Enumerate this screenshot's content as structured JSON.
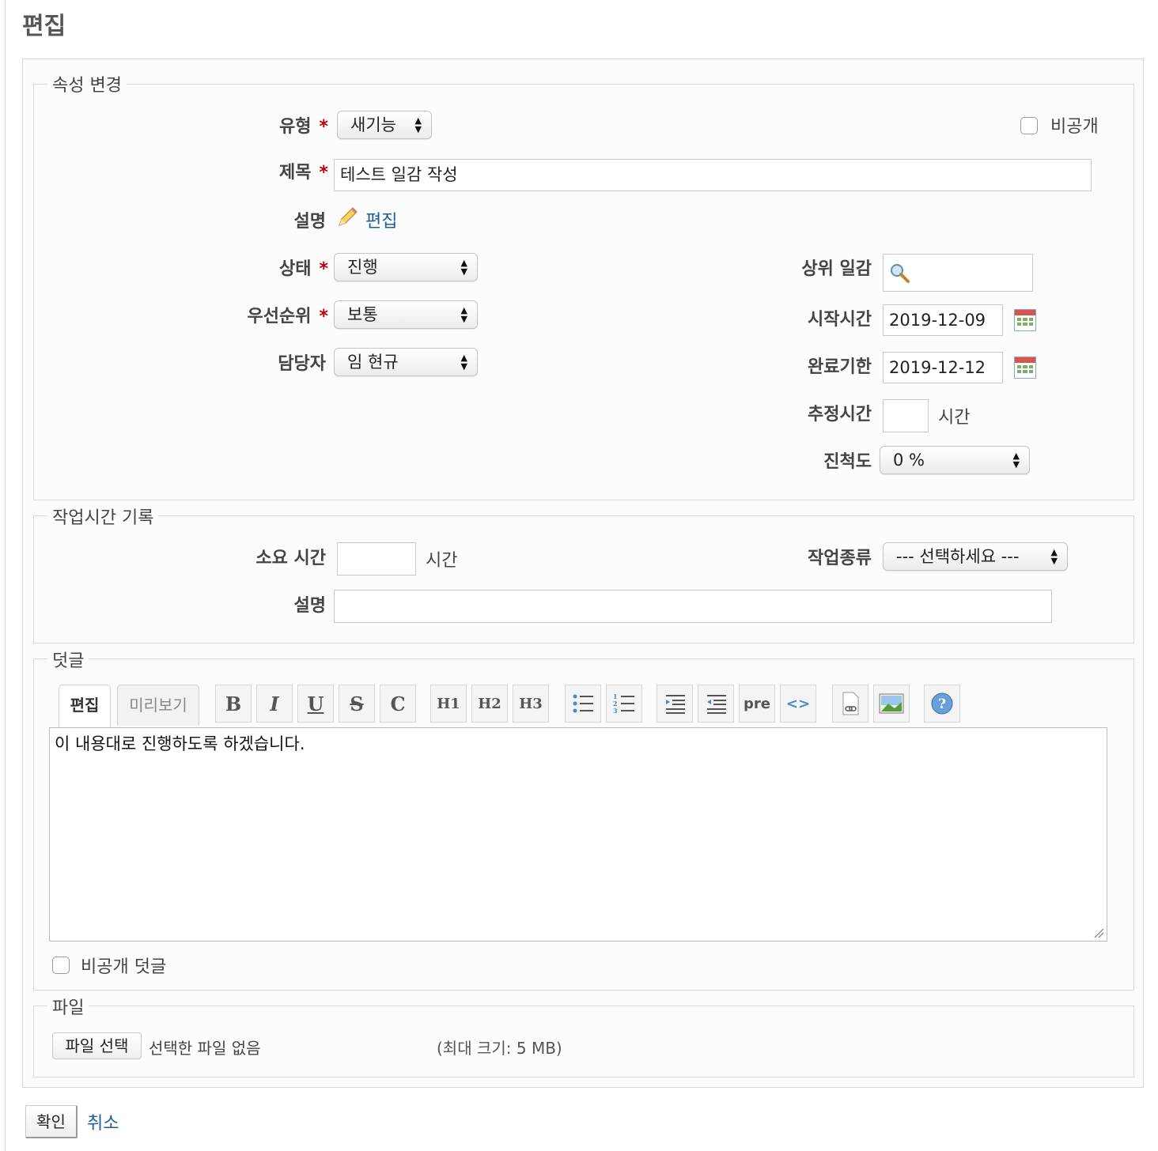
{
  "page": {
    "title": "편집"
  },
  "attributes": {
    "legend": "속성 변경",
    "tracker": {
      "label": "유형",
      "value": "새기능"
    },
    "private": {
      "label": "비공개"
    },
    "subject": {
      "label": "제목",
      "value": "테스트 일감 작성"
    },
    "description": {
      "label": "설명",
      "edit_link": "편집"
    },
    "status": {
      "label": "상태",
      "value": "진행"
    },
    "priority": {
      "label": "우선순위",
      "value": "보통"
    },
    "assignee": {
      "label": "담당자",
      "value": "임 현규"
    },
    "parent": {
      "label": "상위 일감",
      "value": ""
    },
    "start_date": {
      "label": "시작시간",
      "value": "2019-12-09"
    },
    "due_date": {
      "label": "완료기한",
      "value": "2019-12-12"
    },
    "estimated": {
      "label": "추정시간",
      "value": "",
      "unit": "시간"
    },
    "done_ratio": {
      "label": "진척도",
      "value": "0 %"
    },
    "required_mark": "*"
  },
  "time_log": {
    "legend": "작업시간 기록",
    "hours": {
      "label": "소요 시간",
      "value": "",
      "unit": "시간"
    },
    "activity": {
      "label": "작업종류",
      "value": "--- 선택하세요 ---"
    },
    "comment": {
      "label": "설명",
      "value": ""
    }
  },
  "notes": {
    "legend": "덧글",
    "tabs": [
      "편집",
      "미리보기"
    ],
    "toolbar": {
      "bold": "B",
      "italic": "I",
      "underline": "U",
      "strike": "S",
      "code": "C",
      "h1": "H1",
      "h2": "H2",
      "h3": "H3",
      "pre": "pre",
      "inline_code": "<>"
    },
    "text": "이 내용대로 진행하도록 하겠습니다.",
    "private_notes": "비공개 덧글"
  },
  "files": {
    "legend": "파일",
    "choose_button": "파일 선택",
    "no_file": "선택한 파일 없음",
    "max_size": "(최대 크기: 5 MB)"
  },
  "actions": {
    "submit": "확인",
    "cancel": "취소"
  },
  "colors": {
    "required": "#bb0000",
    "link": "#1a5f9c"
  }
}
